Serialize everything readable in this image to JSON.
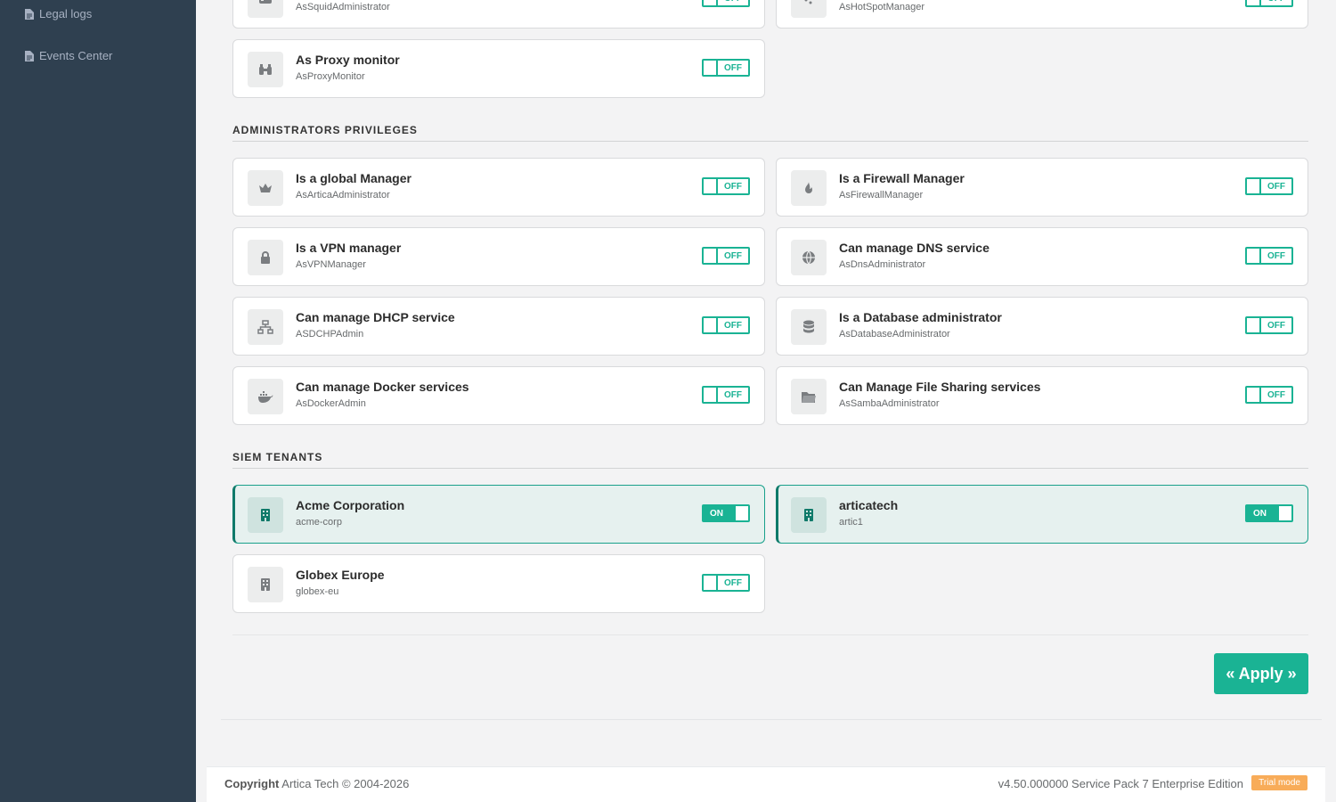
{
  "sidebar": {
    "items": [
      {
        "label": "Legal logs",
        "icon": "file-icon"
      },
      {
        "label": "Events Center",
        "icon": "file-icon"
      }
    ]
  },
  "top_cards": [
    {
      "sub": "AsSquidAdministrator",
      "state": "OFF",
      "icon": "server-icon"
    },
    {
      "sub": "AsHotSpotManager",
      "state": "OFF",
      "icon": "wifi-icon"
    },
    {
      "title": "As Proxy monitor",
      "sub": "AsProxyMonitor",
      "state": "OFF",
      "icon": "binoculars-icon"
    }
  ],
  "admin_section": {
    "title": "ADMINISTRATORS PRIVILEGES",
    "cards": [
      {
        "title": "Is a global Manager",
        "sub": "AsArticaAdministrator",
        "state": "OFF",
        "icon": "crown-icon"
      },
      {
        "title": "Is a Firewall Manager",
        "sub": "AsFirewallManager",
        "state": "OFF",
        "icon": "fire-icon"
      },
      {
        "title": "Is a VPN manager",
        "sub": "AsVPNManager",
        "state": "OFF",
        "icon": "lock-icon"
      },
      {
        "title": "Can manage DNS service",
        "sub": "AsDnsAdministrator",
        "state": "OFF",
        "icon": "globe-icon"
      },
      {
        "title": "Can manage DHCP service",
        "sub": "ASDCHPAdmin",
        "state": "OFF",
        "icon": "network-icon"
      },
      {
        "title": "Is a Database administrator",
        "sub": "AsDatabaseAdministrator",
        "state": "OFF",
        "icon": "database-icon"
      },
      {
        "title": "Can manage Docker services",
        "sub": "AsDockerAdmin",
        "state": "OFF",
        "icon": "docker-icon"
      },
      {
        "title": "Can Manage File Sharing services",
        "sub": "AsSambaAdministrator",
        "state": "OFF",
        "icon": "folder-icon"
      }
    ]
  },
  "siem_section": {
    "title": "SIEM TENANTS",
    "cards": [
      {
        "title": "Acme Corporation",
        "sub": "acme-corp",
        "state": "ON",
        "icon": "building-icon"
      },
      {
        "title": "articatech",
        "sub": "artic1",
        "state": "ON",
        "icon": "building-icon"
      },
      {
        "title": "Globex Europe",
        "sub": "globex-eu",
        "state": "OFF",
        "icon": "building-icon"
      }
    ]
  },
  "apply_label": "« Apply »",
  "footer": {
    "copyright_label": "Copyright",
    "copyright_text": "Artica Tech © 2004-2026",
    "version": "v4.50.000000 Service Pack 7 Enterprise Edition",
    "badge": "Trial mode"
  },
  "colors": {
    "accent": "#1ab394",
    "sidebar": "#2f4050",
    "active_bg": "#e6f1ef",
    "badge": "#f8ac59"
  }
}
